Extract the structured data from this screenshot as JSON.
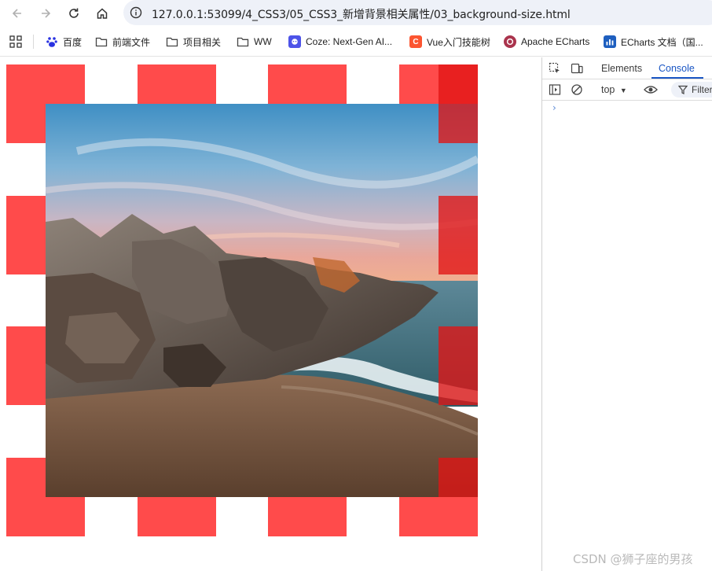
{
  "browser": {
    "url": "127.0.0.1:53099/4_CSS3/05_CSS3_新增背景相关属性/03_background-size.html"
  },
  "bookmarks": [
    {
      "label": "百度",
      "icon": "baidu-paw-icon"
    },
    {
      "label": "前端文件",
      "icon": "folder-icon"
    },
    {
      "label": "项目相关",
      "icon": "folder-icon"
    },
    {
      "label": "WW",
      "icon": "folder-icon"
    },
    {
      "label": "Coze: Next-Gen AI...",
      "icon": "coze-icon"
    },
    {
      "label": "Vue入门技能树",
      "icon": "csdn-c-icon"
    },
    {
      "label": "Apache ECharts",
      "icon": "echarts-icon"
    },
    {
      "label": "ECharts 文档（国...",
      "icon": "echarts-docs-icon"
    }
  ],
  "devtools": {
    "tabs": [
      "Elements",
      "Console"
    ],
    "active_tab": "Console",
    "context": "top",
    "filter_placeholder": "Filter",
    "prompt": "›"
  },
  "page": {
    "tile_color": "#ff4b4b",
    "photo_alt": "rocky beach at sunset"
  },
  "watermark": "CSDN @狮子座的男孩"
}
